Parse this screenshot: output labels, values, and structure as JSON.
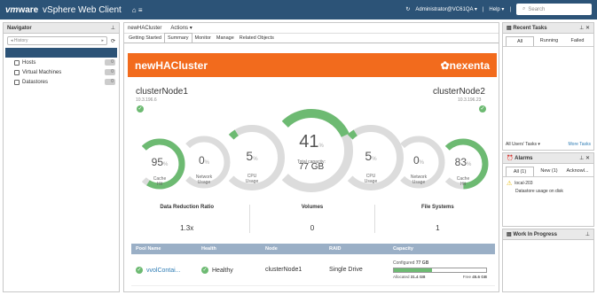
{
  "topbar": {
    "brand_vm": "vm",
    "brand_ware": "ware",
    "brand_product": "vSphere Web Client",
    "home_icon": "home-icon",
    "user": "Administrator@VC61QA",
    "help": "Help",
    "search_placeholder": "Search",
    "dropdown_arrow": "▾"
  },
  "navigator": {
    "title": "Navigator",
    "history_label": "History",
    "items": [
      {
        "label": "Hosts",
        "count": "0"
      },
      {
        "label": "Virtual Machines",
        "count": "0"
      },
      {
        "label": "Datastores",
        "count": "0"
      }
    ]
  },
  "main": {
    "title": "newHACluster",
    "actions": "Actions ▾",
    "tabs": [
      "Getting Started",
      "Summary",
      "Monitor",
      "Manage",
      "Related Objects"
    ],
    "active_tab": "Summary",
    "banner": {
      "cluster": "newHACluster",
      "logo": "nexenta",
      "brand_color": "#f26b1d"
    },
    "left_node": {
      "name": "clusterNode1",
      "ip": "10.3.196.6"
    },
    "right_node": {
      "name": "clusterNode2",
      "ip": "10.3.196.23"
    },
    "percent_sign": "%",
    "gauges": [
      {
        "value": "95",
        "label": "Cache\nHit",
        "fraction": 0.95
      },
      {
        "value": "0",
        "label": "Network\nUsage",
        "fraction": 0.0
      },
      {
        "value": "5",
        "label": "CPU\nUsage",
        "fraction": 0.05
      },
      {
        "value": "41",
        "label": "Total capacity:",
        "sublabel": "77 GB",
        "fraction": 0.41
      },
      {
        "value": "5",
        "label": "CPU\nUsage",
        "fraction": 0.05
      },
      {
        "value": "0",
        "label": "Network\nUsage",
        "fraction": 0.0
      },
      {
        "value": "83",
        "label": "Cache\nHit",
        "fraction": 0.83
      }
    ],
    "stats": [
      {
        "title": "Data Reduction Ratio",
        "value": "1.3x"
      },
      {
        "title": "Volumes",
        "value": "0"
      },
      {
        "title": "File Systems",
        "value": "1"
      }
    ],
    "table": {
      "headers": [
        "Pool Name",
        "Health",
        "Node",
        "RAID",
        "Capacity"
      ],
      "row": {
        "pool": "vvolContai...",
        "health": "Healthy",
        "node": "clusterNode1",
        "raid": "Single Drive",
        "configured_label": "Configured",
        "configured": "77 GB",
        "allocated_label": "Allocated",
        "allocated": "31.4 GB",
        "free_label": "Free",
        "free": "45.6 GB",
        "used_fraction": 0.41
      }
    }
  },
  "recent_tasks": {
    "title": "Recent Tasks",
    "tabs": [
      "All",
      "Running",
      "Failed"
    ],
    "footer_left": "All Users' Tasks ▾",
    "footer_right": "More Tasks"
  },
  "alarms": {
    "title": "Alarms",
    "tabs": [
      "All (1)",
      "New (1)",
      "Acknowl..."
    ],
    "item_name": "local-203",
    "item_desc": "Datastore usage on disk"
  },
  "wip": {
    "title": "Work In Progress"
  },
  "colors": {
    "accent": "#2c5377",
    "gauge_fill": "#6dba72",
    "gauge_track": "#dcdcdc"
  }
}
